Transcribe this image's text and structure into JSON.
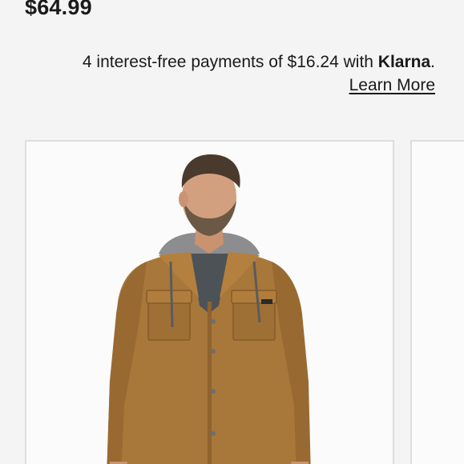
{
  "product": {
    "price": "$64.99"
  },
  "klarna": {
    "text_before": "4 interest-free payments of $16.24 with ",
    "brand": "Klarna",
    "text_after": ".",
    "learn_more": "Learn More"
  },
  "gallery": {
    "images": [
      {
        "subject": "model wearing brown duck hooded shirt jacket"
      },
      {
        "subject": "next product image (partially visible)"
      }
    ]
  },
  "colors": {
    "background": "#f4f4f4",
    "text": "#1a1a1a",
    "card_border": "#dedede",
    "jacket": "#a8773a"
  }
}
